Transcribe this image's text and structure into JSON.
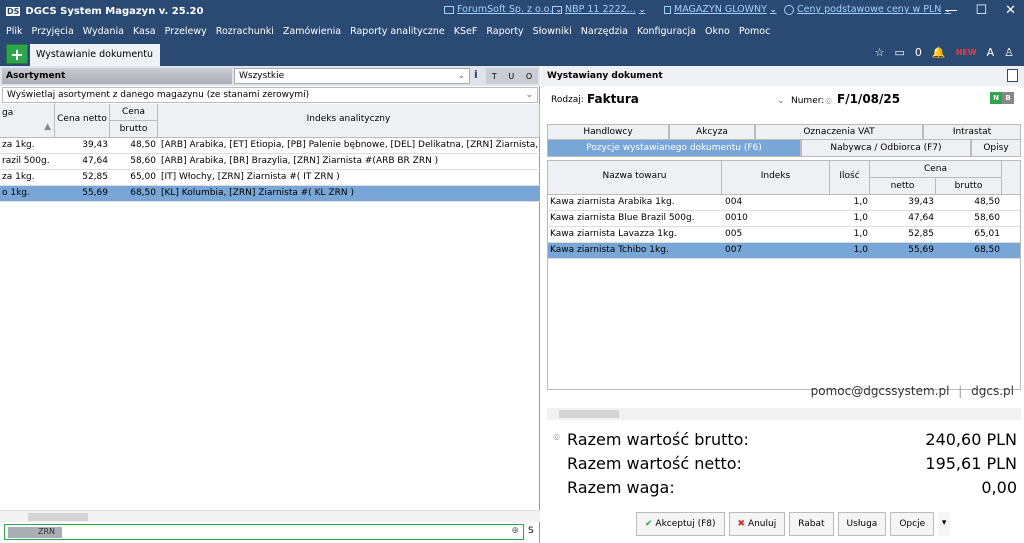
{
  "titlebar": {
    "logo": "DS",
    "app_title": "DGCS System Magazyn v. 25.20",
    "company": "ForumSoft Sp. z o.o.",
    "bank": "NBP 11 2222...",
    "warehouse": "MAGAZYN GLOWNY",
    "prices": "Ceny podstawowe ceny w PLN",
    "minimize": "—",
    "maximize": "☐",
    "close": "✕"
  },
  "menu": [
    "Plik",
    "Przyjęcia",
    "Wydania",
    "Kasa",
    "Przelewy",
    "Rozrachunki",
    "Zamówienia",
    "Raporty analityczne",
    "KSeF",
    "Raporty",
    "Słowniki",
    "Narzędzia",
    "Konfiguracja",
    "Okno",
    "Pomoc"
  ],
  "tabbar": {
    "add_label": "+",
    "doc_tab": "Wystawianie dokumentu",
    "counter": "0",
    "star": "☆",
    "bell": "🔔",
    "badge": "NEW",
    "font_size": "A"
  },
  "left": {
    "header": "Asortyment",
    "filter_select": "Wszystkie",
    "info": "i",
    "tuo": [
      "T",
      "U",
      "O"
    ],
    "filter_row": "Wyświetlaj asortyment z danego magazynu (ze stanami zerowymi)",
    "columns": {
      "name": "ga",
      "netto": "Cena netto",
      "cena": "Cena",
      "brutto": "brutto",
      "index": "Indeks analityczny"
    },
    "rows": [
      {
        "name": "za 1kg.",
        "netto": "39,43",
        "brutto": "48,50",
        "index": "[ARB] Arabika, [ET] Etiopia, [PB] Palenie bębnowe, [DEL] Delikatna, [ZRN] Ziarnista, [SL] Słodki"
      },
      {
        "name": "razil 500g.",
        "netto": "47,64",
        "brutto": "58,60",
        "index": "[ARB] Arabika, [BR] Brazylia, [ZRN] Ziarnista     #(ARB BR      ZRN  )"
      },
      {
        "name": "za 1kg.",
        "netto": "52,85",
        "brutto": "65,00",
        "index": "[IT] Włochy, [ZRN] Ziarnista      #(     IT       ZRN   )"
      },
      {
        "name": "o 1kg.",
        "netto": "55,69",
        "brutto": "68,50",
        "index": "[KL] Kolumbia, [ZRN] Ziarnista      #(     KL       ZRN   )"
      }
    ],
    "search_chip": "ZRN",
    "search_icon": "⊕",
    "s_label": "S"
  },
  "right": {
    "title": "Wystawiany dokument",
    "rodzaj_label": "Rodzaj:",
    "rodzaj_value": "Faktura",
    "numer_label": "Numer:",
    "numer_value": "F/1/08/25",
    "nb": [
      "N",
      "B"
    ],
    "tabs_top": [
      "Handlowcy",
      "Akcyza",
      "Oznaczenia VAT",
      "Intrastat"
    ],
    "tabs_bottom": [
      "Pozycje wystawianego dokumentu (F6)",
      "Nabywca / Odbiorca (F7)",
      "Opisy"
    ],
    "columns": {
      "name": "Nazwa towaru",
      "index": "Indeks",
      "qty": "Ilość",
      "cena": "Cena",
      "netto": "netto",
      "brutto": "brutto"
    },
    "rows": [
      {
        "name": "Kawa ziarnista Arabika 1kg.",
        "index": "004",
        "qty": "1,0",
        "netto": "39,43",
        "brutto": "48,50"
      },
      {
        "name": "Kawa ziarnista Blue Brazil 500g.",
        "index": "0010",
        "qty": "1,0",
        "netto": "47,64",
        "brutto": "58,60"
      },
      {
        "name": "Kawa ziarnista Lavazza 1kg.",
        "index": "005",
        "qty": "1,0",
        "netto": "52,85",
        "brutto": "65,01"
      },
      {
        "name": "Kawa ziarnista Tchibo 1kg.",
        "index": "007",
        "qty": "1,0",
        "netto": "55,69",
        "brutto": "68,50"
      }
    ],
    "contact_email": "pomoc@dgcssystem.pl",
    "contact_sep": "|",
    "contact_site": "dgcs.pl",
    "sums": {
      "brutto_label": "Razem wartość brutto:",
      "brutto_value": "240,60 PLN",
      "netto_label": "Razem wartość netto:",
      "netto_value": "195,61 PLN",
      "waga_label": "Razem waga:",
      "waga_value": "0,00"
    },
    "buttons": {
      "accept": "Akceptuj (F8)",
      "cancel": "Anuluj",
      "rabat": "Rabat",
      "usluga": "Usługa",
      "opcje": "Opcje",
      "more": "▾"
    }
  },
  "colors": {
    "titlebar_bg": "#2b4a73",
    "selected_row": "#78a6d6",
    "add_green": "#2ea44f"
  }
}
